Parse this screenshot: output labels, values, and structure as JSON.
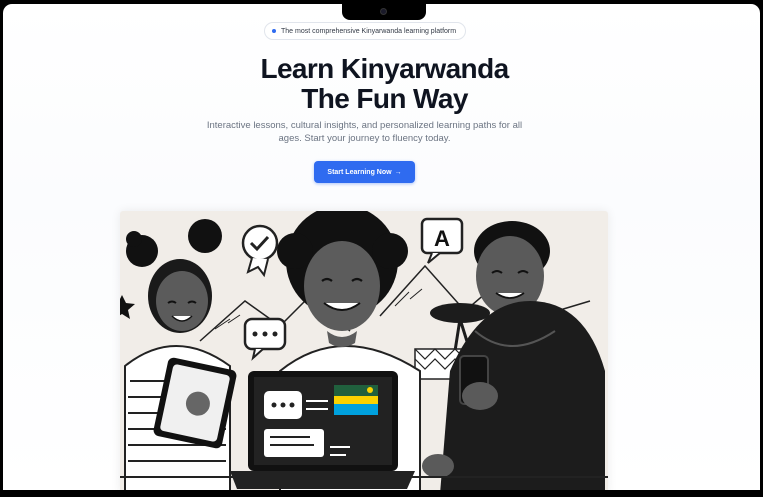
{
  "badge": {
    "text": "The most comprehensive Kinyarwanda learning platform"
  },
  "hero": {
    "title_line1": "Learn Kinyarwanda",
    "title_line2": "The Fun Way",
    "subtitle": "Interactive lessons, cultural insights, and personalized learning paths for all ages. Start your journey to fluency today.",
    "cta_label": "Start Learning Now",
    "cta_icon": "arrow-right-icon"
  },
  "illustration": {
    "speech_bubble_letter": "A",
    "icons": [
      "checkmark-badge-icon",
      "letter-a-speech-icon",
      "chat-ellipsis-icon",
      "rwanda-flag-icon"
    ]
  },
  "colors": {
    "accent": "#2f6bf0",
    "title": "#0f1420",
    "muted": "#6b7482",
    "illustration_bg": "#f1ede8"
  }
}
